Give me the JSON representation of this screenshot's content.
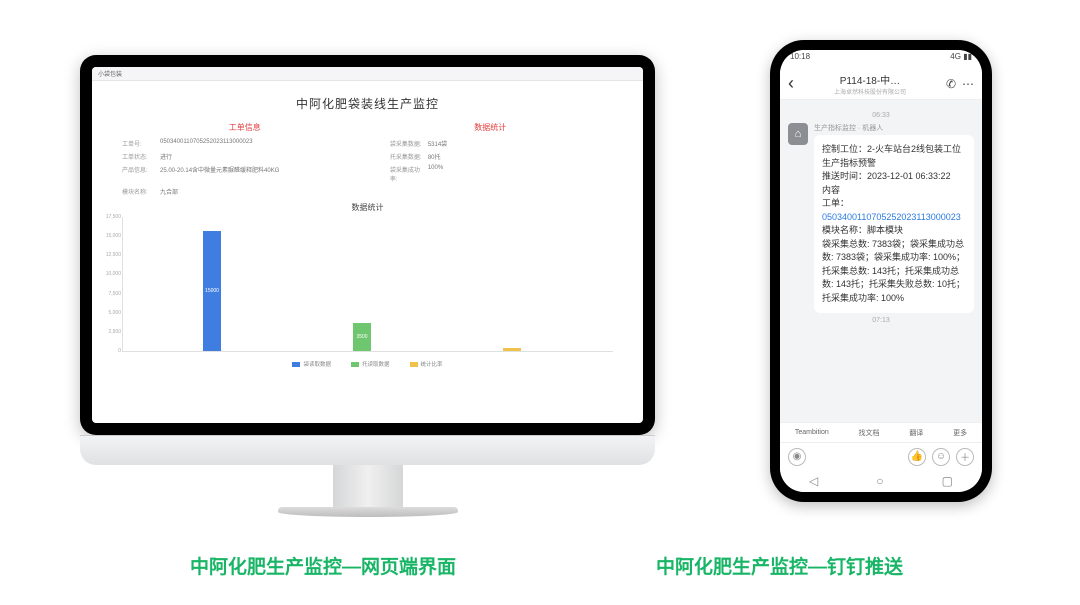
{
  "captions": {
    "left": "中阿化肥生产监控—网页端界面",
    "right": "中阿化肥生产监控—钉钉推送"
  },
  "web": {
    "tab": "小袋包装",
    "title": "中阿化肥袋装线生产监控",
    "left_heading": "工单信息",
    "right_heading": "数据统计",
    "rows": [
      {
        "l_label": "工单号:",
        "l_val": "0503400110705252023113000023",
        "r_label": "袋采集数据:",
        "r_val": "5314袋"
      },
      {
        "l_label": "工单状态:",
        "l_val": "进行",
        "r_label": "托采集数据:",
        "r_val": "80托"
      },
      {
        "l_label": "产品信息:",
        "l_val": "25.00-20.14含中微量元素脲醛缓释肥料40KG",
        "r_label": "袋采集成功率:",
        "r_val": "100%"
      },
      {
        "l_label": "模块名称:",
        "l_val": "九合部",
        "r_label": "",
        "r_val": ""
      }
    ]
  },
  "chart_data": {
    "type": "bar",
    "title": "数据统计",
    "categories": [
      "袋读取数据",
      "托读取数据",
      "统计比率"
    ],
    "series": [
      {
        "name": "袋读取数据",
        "color": "#3f7de0"
      },
      {
        "name": "托读取数据",
        "color": "#6ec66e"
      },
      {
        "name": "统计比率",
        "color": "#f0c24b"
      }
    ],
    "values": [
      15000,
      3500,
      250
    ],
    "yticks": [
      "17,500",
      "15,000",
      "12,500",
      "10,000",
      "7,500",
      "5,000",
      "2,500",
      "0"
    ],
    "ylim": [
      0,
      17500
    ]
  },
  "phone": {
    "status_left": "10:18",
    "status_right": "4G ▮▮",
    "title": "P114-18-中…",
    "subtitle": "上海卓然科技股份有限公司",
    "time1": "06:33",
    "sender": "生产指标监控 · 机器人",
    "msg": {
      "l1": "控制工位：2-火车站台2线包装工位",
      "l2": "生产指标预警",
      "l3": "推送时间：2023-12-01 06:33:22",
      "l4": "内容",
      "l5": "工单：",
      "link": "0503400110705252023113000023",
      "l6": "模块名称：脚本模块",
      "l7": "袋采集总数: 7383袋；袋采集成功总数: 7383袋；袋采集成功率: 100%；托采集总数: 143托；托采集成功总数: 143托；托采集失败总数: 10托；托采集成功率: 100%"
    },
    "time2": "07:13",
    "quick": [
      "Teambition",
      "找文档",
      "翻译",
      "更多"
    ],
    "nav": [
      "◁",
      "○",
      "▢"
    ]
  }
}
